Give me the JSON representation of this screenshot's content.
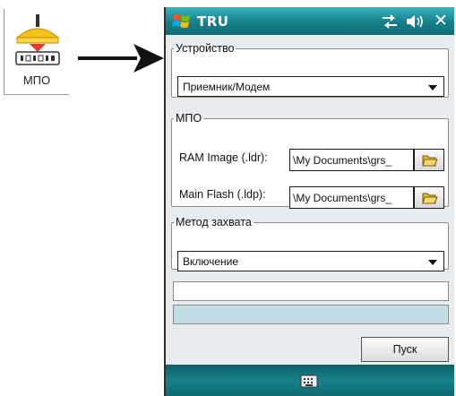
{
  "launcher": {
    "icon": "mpo-antenna-icon",
    "label": "МПО"
  },
  "window": {
    "title": "TRU",
    "status_icons": [
      "signal-sync-icon",
      "volume-icon"
    ],
    "close_glyph": "✕"
  },
  "device_group": {
    "legend": "Устройство",
    "selected": "Приемник/Модем"
  },
  "mpo_group": {
    "legend": "МПО",
    "ram_label": "RAM Image (.ldr):",
    "ram_value": "\\My Documents\\grs_",
    "flash_label": "Main Flash (.ldp):",
    "flash_value": "\\My Documents\\grs_"
  },
  "capture_group": {
    "legend": "Метод захвата",
    "selected": "Включение"
  },
  "status": {
    "text": "",
    "progress": 0
  },
  "start_button": "Пуск",
  "colors": {
    "titlebar": "#1a8c96",
    "progress_bg": "#c3dde6",
    "window_bg": "#e9ecef"
  }
}
